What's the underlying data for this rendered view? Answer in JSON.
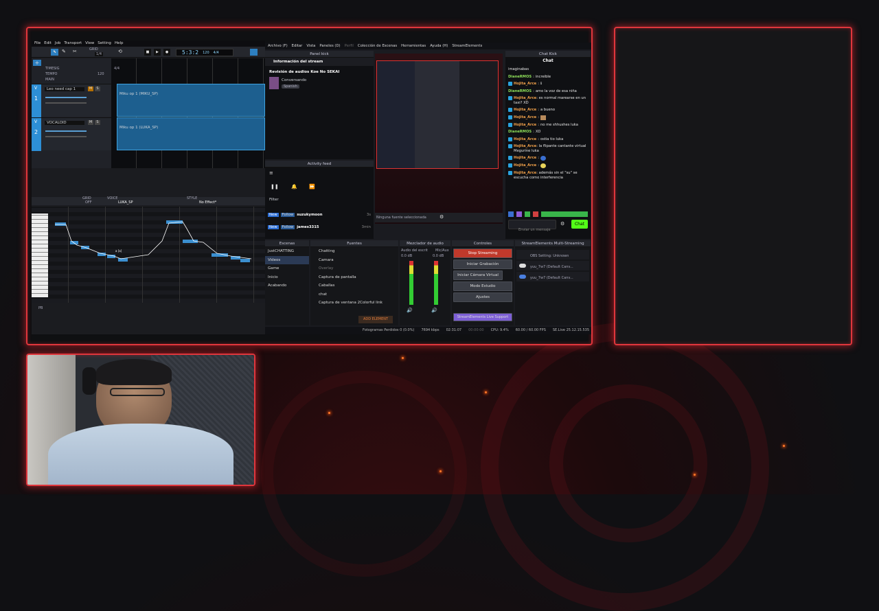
{
  "vocaloid_editor": {
    "menu": [
      "File",
      "Edit",
      "Job",
      "Transport",
      "View",
      "Setting",
      "Help"
    ],
    "grid_label": "GRID",
    "grid_value": "1/4",
    "time_display": "5:3:2",
    "tempo_display": "120",
    "timesig_display": "4/4",
    "tracks_header": [
      "TIMESIG",
      "TEMPO",
      "MAIN"
    ],
    "tempo_value": "120",
    "timesig_value": "4/4",
    "tracks": [
      {
        "number": "1",
        "name": "Leo need cap 1",
        "part": "Miku op 1 (MIKU_SP)"
      },
      {
        "number": "2",
        "name": "VOCALOID",
        "part": "Miku op 1 (LUKA_SP)"
      }
    ],
    "bottom_bar": {
      "grid_label": "GRID",
      "grid_value": "OFF",
      "voice_label": "VOICE",
      "voice_value": "LUKA_SP",
      "style_label": "STYLE",
      "style_value": "No Effect*"
    },
    "pb_label": "PB",
    "letters": {
      "track": "V",
      "mute": "M",
      "solo": "S"
    },
    "lyric_tag": "a [a]"
  },
  "obs": {
    "menu": [
      "Archivo (F)",
      "Editar",
      "Vista",
      "Paneles (D)",
      "Perfil",
      "Colección de Escenas",
      "Herramientas",
      "Ayuda (H)",
      "StreamElements"
    ],
    "panel_kick_title": "Panel kick",
    "stream_info_title": "Información del stream",
    "stream_title": "Revisión de audios Koe No SEKAI",
    "stream_category": "Conversando",
    "stream_language": "Spanish",
    "activity_feed_title": "Activity feed",
    "filter_label": "Filter",
    "feed": [
      {
        "tag": "New",
        "type": "Follow",
        "user": "suzukymoon",
        "time": "3s"
      },
      {
        "tag": "New",
        "type": "Follow",
        "user": "james3315",
        "time": "3min"
      }
    ],
    "chat_kick_title": "Chat Kick",
    "chat_header": "Chat",
    "chat_input_placeholder": "Enviar un mensaje",
    "chat_button": "Chat",
    "chat": [
      {
        "user": "",
        "text": "imaginabas"
      },
      {
        "user": "DianeRMOS",
        "text": "increible"
      },
      {
        "user": "Hojita_Arce",
        "text": "ℹ"
      },
      {
        "user": "DianeRMOS",
        "text": "amo la voz de esa niña"
      },
      {
        "user": "Hojita_Arce",
        "text": "es normal marearse en un taxi? XD"
      },
      {
        "user": "Hojita_Arce",
        "text": "a bueno"
      },
      {
        "user": "Hojita_Arce",
        "text": ""
      },
      {
        "user": "Hojita_Arce",
        "text": "no me shhushes luka"
      },
      {
        "user": "DianeRMOS",
        "text": "XD"
      },
      {
        "user": "Hojita_Arce",
        "text": "ostia tio luka"
      },
      {
        "user": "Hojita_Arce",
        "text": "la flipante cantante virtual Megurine luka"
      },
      {
        "user": "Hojita_Arce",
        "text": ""
      },
      {
        "user": "Hojita_Arce",
        "text": ""
      },
      {
        "user": "Hojita_Arce",
        "text": "además sin el \"su\" se escucha como interferencia"
      }
    ],
    "preview_status": "Ninguna fuente seleccionada",
    "docks": {
      "scenes": "Escenas",
      "sources": "Fuentes",
      "mixer": "Mezclador de audio",
      "controls": "Controles",
      "multistream": "StreamElements Multi-Streaming"
    },
    "scenes": [
      "JustCHATTING",
      "Videos",
      "Game",
      "Inicio",
      "Acabando"
    ],
    "sources": [
      "Chatting",
      "Camara",
      "Overlay",
      "Captura de pantalla",
      "Caballas",
      "chat",
      "Captura de ventana 2Colorful link"
    ],
    "add_element": "ADD ELEMENT",
    "mixer": [
      {
        "name": "Audio del escrit",
        "db": "0.0 dB"
      },
      {
        "name": "Mic/Aux",
        "db": "0.0 dB"
      }
    ],
    "controls": [
      "Stop Streaming",
      "Iniciar Grabación",
      "Iniciar Cámara Virtual",
      "Modo Estudio",
      "Ajustes"
    ],
    "live_support": "StreamElements Live Support",
    "multistream": [
      {
        "name": "OBS Setting: Unknown"
      },
      {
        "name": "yuu_7w7 (Default Canv..."
      },
      {
        "name": "yuu_7w7 (Default Canv..."
      }
    ],
    "statusbar": {
      "dropped": "Fotogramas Perdidos 0 (0.0%)",
      "kbps": "7694 kbps",
      "live": "02:31:07",
      "rec": "00:00:00",
      "cpu": "CPU: 9.4%",
      "fps": "60.00 / 60.00 FPS",
      "version": "SE.Live 25.12.15.535"
    }
  },
  "colors": {
    "frame": "#e0363c",
    "accent_blue": "#2aa3e0",
    "stop_red": "#c0392b",
    "chat_green": "#53fc18"
  }
}
